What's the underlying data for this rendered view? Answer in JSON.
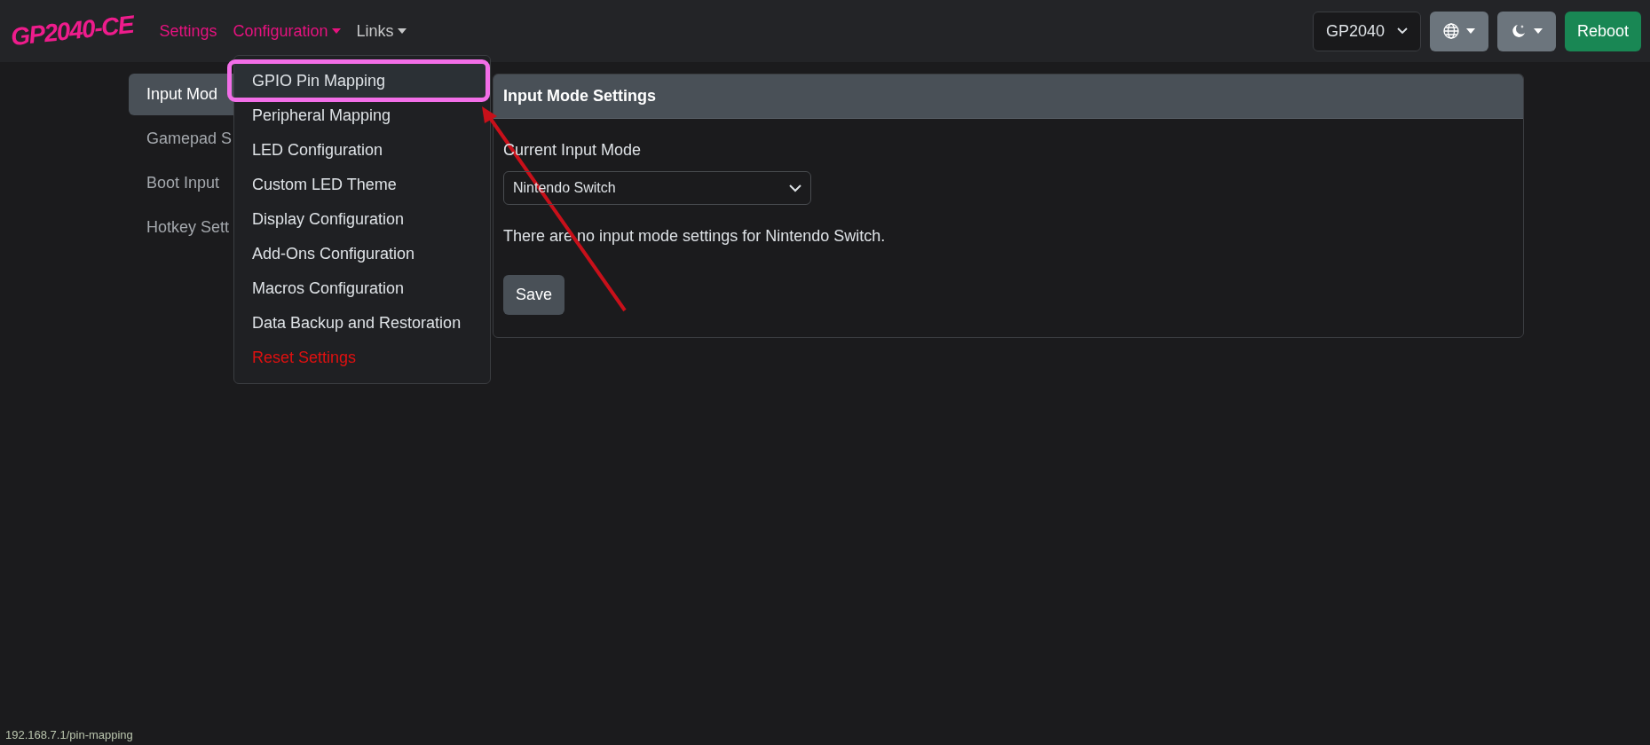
{
  "navbar": {
    "logo": "GP2040-CE",
    "links": [
      {
        "label": "Settings",
        "color": "#e6127f",
        "dropdown": false
      },
      {
        "label": "Configuration",
        "color": "#e6127f",
        "dropdown": true
      },
      {
        "label": "Links",
        "color": "#c6c7c8",
        "dropdown": true
      }
    ],
    "board_select": {
      "value": "GP2040"
    },
    "reboot_button": "Reboot"
  },
  "sidebar": {
    "items": [
      {
        "label": "Input Mod",
        "selected": true
      },
      {
        "label": "Gamepad S",
        "selected": false
      },
      {
        "label": "Boot Input",
        "selected": false
      },
      {
        "label": "Hotkey Sett",
        "selected": false
      }
    ]
  },
  "dropdown_menu": {
    "items": [
      {
        "label": "GPIO Pin Mapping",
        "kind": "normal",
        "active": true,
        "annotated": true
      },
      {
        "label": "Peripheral Mapping",
        "kind": "normal",
        "active": false,
        "annotated": false
      },
      {
        "label": "LED Configuration",
        "kind": "normal",
        "active": false,
        "annotated": false
      },
      {
        "label": "Custom LED Theme",
        "kind": "normal",
        "active": false,
        "annotated": false
      },
      {
        "label": "Display Configuration",
        "kind": "normal",
        "active": false,
        "annotated": false
      },
      {
        "label": "Add-Ons Configuration",
        "kind": "normal",
        "active": false,
        "annotated": false
      },
      {
        "label": "Macros Configuration",
        "kind": "normal",
        "active": false,
        "annotated": false
      },
      {
        "label": "Data Backup and Restoration",
        "kind": "normal",
        "active": false,
        "annotated": false
      },
      {
        "label": "Reset Settings",
        "kind": "danger",
        "active": false,
        "annotated": false
      }
    ]
  },
  "panel": {
    "title": "Input Mode Settings",
    "field_label": "Current Input Mode",
    "select_value": "Nintendo Switch",
    "message": "There are no input mode settings for Nintendo Switch.",
    "save_button": "Save"
  },
  "status_bar": {
    "url": "192.168.7.1/pin-mapping"
  }
}
